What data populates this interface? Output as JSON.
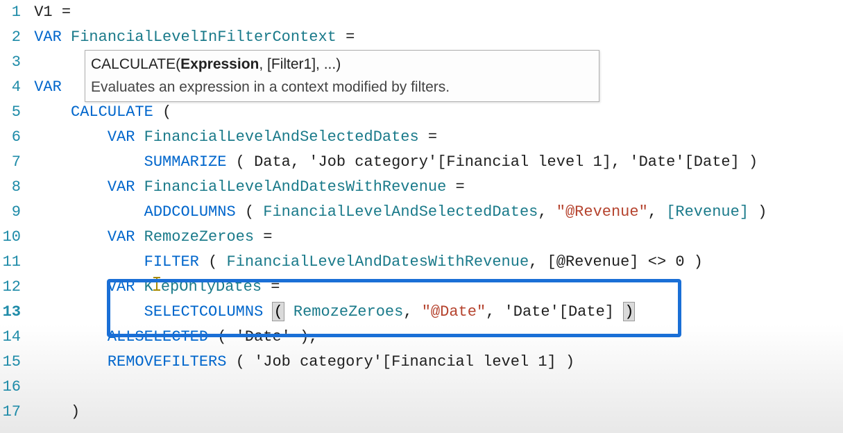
{
  "lines": {
    "l1": {
      "num": "1",
      "measure": "V1",
      "eq": "="
    },
    "l2": {
      "num": "2",
      "var": "VAR",
      "name": "FinancialLevelInFilterContext",
      "eq": "="
    },
    "l3": {
      "num": "3"
    },
    "l4": {
      "num": "4",
      "var": "VAR"
    },
    "l5": {
      "num": "5",
      "fn": "CALCULATE",
      "paren": "("
    },
    "l6": {
      "num": "6",
      "var": "VAR",
      "name": "FinancialLevelAndSelectedDates",
      "eq": "="
    },
    "l7": {
      "num": "7",
      "fn": "SUMMARIZE",
      "p1": "(",
      "t1": "Data",
      "c1": ",",
      "t2": "'Job category'[Financial level 1]",
      "c2": ",",
      "t3": "'Date'[Date]",
      "p2": ")"
    },
    "l8": {
      "num": "8",
      "var": "VAR",
      "name": "FinancialLevelAndDatesWithRevenue",
      "eq": "="
    },
    "l9": {
      "num": "9",
      "fn": "ADDCOLUMNS",
      "p1": "(",
      "t1": "FinancialLevelAndSelectedDates",
      "c1": ",",
      "s1": "\"@Revenue\"",
      "c2": ",",
      "t2": "[Revenue]",
      "p2": ")"
    },
    "l10": {
      "num": "10",
      "var": "VAR",
      "name": "RemozeZeroes",
      "eq": "="
    },
    "l11": {
      "num": "11",
      "fn": "FILTER",
      "p1": "(",
      "t1": "FinancialLevelAndDatesWithRevenue",
      "c1": ",",
      "t2": "[@Revenue]",
      "op": "<>",
      "t3": "0",
      "p2": ")"
    },
    "l12": {
      "num": "12",
      "var": "VAR",
      "name_a": "K",
      "name_b": "epOnlyDates",
      "eq": "="
    },
    "l13": {
      "num": "13",
      "fn": "SELECTCOLUMNS",
      "p1": "(",
      "t1": "RemozeZeroes",
      "c1": ",",
      "s1": "\"@Date\"",
      "c2": ",",
      "t2": "'Date'[Date]",
      "p2": ")"
    },
    "l14": {
      "num": "14",
      "fn": "ALLSELECTED",
      "p1": "(",
      "t1": "'Date'",
      "p2": ")",
      "c1": ","
    },
    "l15": {
      "num": "15",
      "fn": "REMOVEFILTERS",
      "p1": "(",
      "t1": "'Job category'[Financial level 1]",
      "p2": ")"
    },
    "l16": {
      "num": "16"
    },
    "l17": {
      "num": "17",
      "p": ")"
    }
  },
  "tooltip": {
    "sig_fn": "CALCULATE(",
    "sig_bold": "Expression",
    "sig_rest": ", [Filter1], ...)",
    "desc": "Evaluates an expression in a context modified by filters."
  }
}
